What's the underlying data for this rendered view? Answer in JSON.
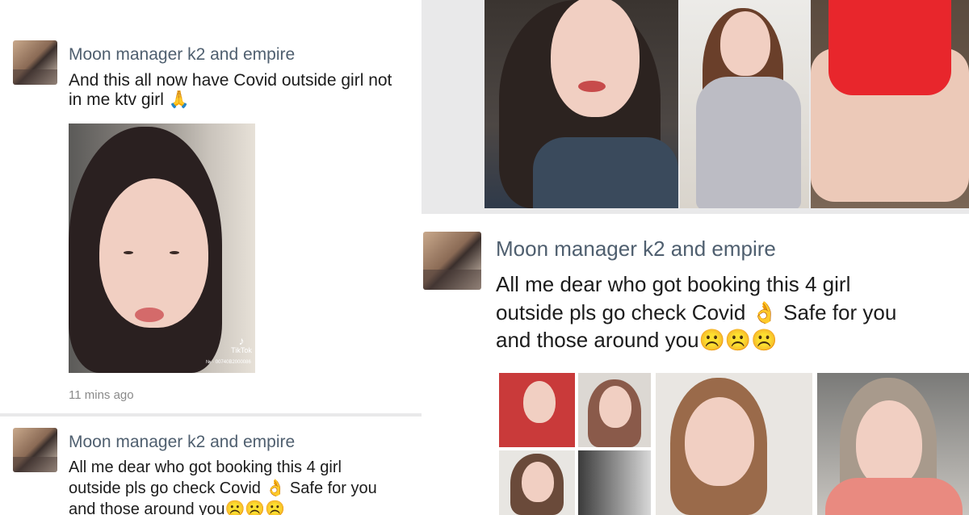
{
  "posts": [
    {
      "author": "Moon manager k2 and empire",
      "lines": [
        "And this all now have Covid outside girl not",
        "in me ktv girl 🙏"
      ],
      "time": "11 mins ago",
      "video_watermark": "TikTok",
      "video_id": "№ · 00740B2000086"
    },
    {
      "author": "Moon manager k2 and empire",
      "lines": [
        "All me dear who got booking this 4 girl",
        "outside pls go check Covid 👌 Safe for you",
        "and those around you☹️☹️☹️"
      ]
    },
    {
      "author": "Moon manager k2 and empire",
      "lines": [
        "All me dear who got booking this 4 girl",
        "outside pls go check Covid 👌 Safe for you",
        "and those around you☹️☹️☹️"
      ]
    }
  ],
  "colors": {
    "author": "#4f5f6f",
    "text": "#1c1c1c",
    "time": "#8a8a8a",
    "background": "#e9e9ea"
  }
}
